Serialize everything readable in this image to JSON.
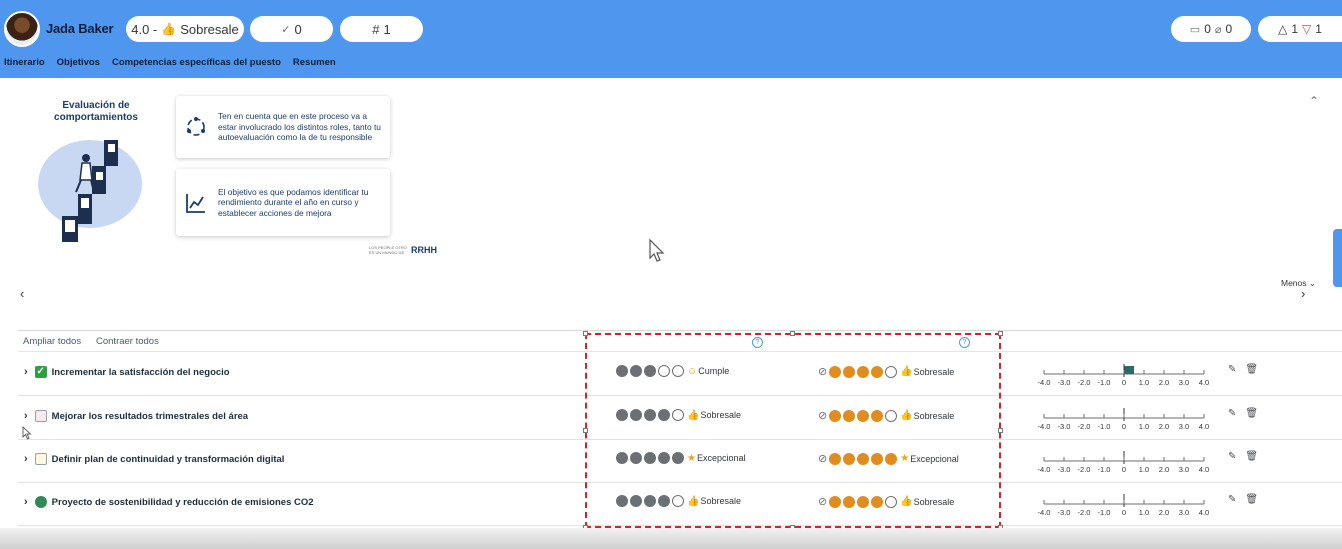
{
  "header": {
    "user_name": "Jada Baker",
    "score_value": "4.0 -",
    "score_label": "Sobresale",
    "check_count": "0",
    "rank_symbol": "#",
    "rank_value": "1",
    "notes_count": "0",
    "attach_count": "0",
    "up_count": "1",
    "down_count": "1",
    "brand_color": "#4f97ee"
  },
  "tabs": [
    "Itinerario",
    "Objetivos",
    "Competencias específicas del puesto",
    "Resumen"
  ],
  "banner": {
    "title": "Evaluación de comportamientos",
    "card1_text": "Ten en cuenta que en este proceso va a estar involucrado los distintos roles, tanto tu autoevaluación como la de tu responsible",
    "card2_text": "El objetivo es que podamos identificar tu rendimiento durante el año en curso y establecer acciones de mejora",
    "brand_small": "LOS PEOPLE OTRO ES UN MUNDO DE",
    "brand_big": "RRHH"
  },
  "menos_label": "Menos",
  "toolbar": {
    "expand_all": "Ampliar todos",
    "collapse_all": "Contraer todos",
    "help_glyph": "?"
  },
  "scale_ticks": [
    "-4.0",
    "-3.0",
    "-2.0",
    "-1.0",
    "0",
    "1.0",
    "2.0",
    "3.0",
    "4.0"
  ],
  "rows": [
    {
      "title": "Incrementar la satisfacción del negocio",
      "status_icon": "check-square-icon",
      "self_rating": {
        "filled": 3,
        "total": 5,
        "label": "Cumple",
        "icon": "smile-icon"
      },
      "manager_rating": {
        "filled": 4,
        "total": 5,
        "label": "Sobresale",
        "icon": "thumbs-up-icon"
      },
      "scale_value": 0.5
    },
    {
      "title": "Mejorar los resultados trimestrales del área",
      "status_icon": "chart-icon",
      "self_rating": {
        "filled": 4,
        "total": 5,
        "label": "Sobresale",
        "icon": "thumbs-up-icon"
      },
      "manager_rating": {
        "filled": 4,
        "total": 5,
        "label": "Sobresale",
        "icon": "thumbs-up-icon"
      },
      "scale_value": 0
    },
    {
      "title": "Definir plan de continuidad y transformación digital",
      "status_icon": "document-icon",
      "self_rating": {
        "filled": 5,
        "total": 5,
        "label": "Excepcional",
        "icon": "star-icon"
      },
      "manager_rating": {
        "filled": 5,
        "total": 5,
        "label": "Excepcional",
        "icon": "star-icon"
      },
      "scale_value": 0
    },
    {
      "title": "Proyecto de sostenibilidad y reducción de emisiones CO2",
      "status_icon": "circle-icon",
      "self_rating": {
        "filled": 4,
        "total": 5,
        "label": "Sobresale",
        "icon": "thumbs-up-icon"
      },
      "manager_rating": {
        "filled": 4,
        "total": 5,
        "label": "Sobresale",
        "icon": "thumbs-up-icon"
      },
      "scale_value": 0
    }
  ],
  "colors": {
    "self_dot": "#6c6f73",
    "manager_dot": "#e08c1f",
    "highlight": "#d9212b",
    "scale_bar": "#2a6b6b"
  }
}
